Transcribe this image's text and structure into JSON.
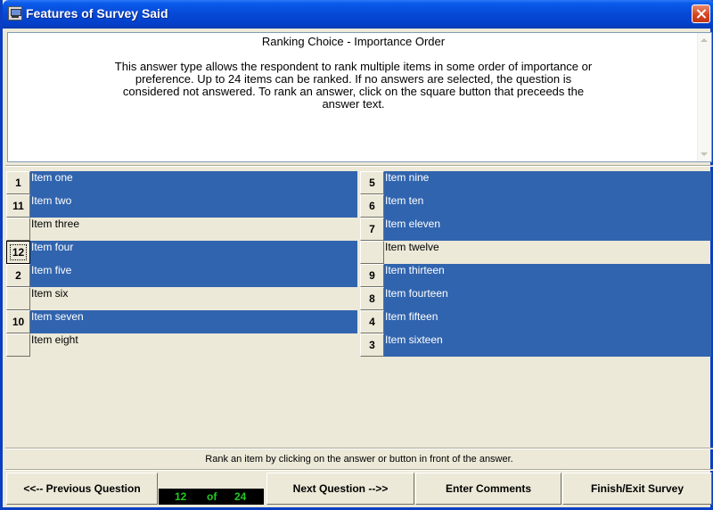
{
  "window": {
    "title": "Features of Survey Said"
  },
  "question": {
    "title": "Ranking Choice - Importance Order",
    "body": "This answer type allows the respondent to rank multiple items in some order of importance or preference. Up to 24 items can be ranked. If no answers are selected, the question is considered not answered. To rank an answer, click on the square button that preceeds the answer text."
  },
  "left_items": [
    {
      "rank": "1",
      "label": "Item one",
      "selected": true
    },
    {
      "rank": "11",
      "label": "Item two",
      "selected": true
    },
    {
      "rank": "",
      "label": "Item three",
      "selected": false
    },
    {
      "rank": "12",
      "label": "Item four",
      "selected": true,
      "focused": true
    },
    {
      "rank": "2",
      "label": "Item five",
      "selected": true
    },
    {
      "rank": "",
      "label": "Item six",
      "selected": false
    },
    {
      "rank": "10",
      "label": "Item seven",
      "selected": true
    },
    {
      "rank": "",
      "label": "Item eight",
      "selected": false
    }
  ],
  "right_items": [
    {
      "rank": "5",
      "label": "Item nine",
      "selected": true
    },
    {
      "rank": "6",
      "label": "Item ten",
      "selected": true
    },
    {
      "rank": "7",
      "label": "Item eleven",
      "selected": true
    },
    {
      "rank": "",
      "label": "Item twelve",
      "selected": false
    },
    {
      "rank": "9",
      "label": "Item thirteen",
      "selected": true
    },
    {
      "rank": "8",
      "label": "Item fourteen",
      "selected": true
    },
    {
      "rank": "4",
      "label": "Item fifteen",
      "selected": true
    },
    {
      "rank": "3",
      "label": "Item sixteen",
      "selected": true
    }
  ],
  "hint": "Rank an item by clicking on the answer or button in front of the answer.",
  "nav": {
    "prev_label": "<<-- Previous Question",
    "next_label": "Next Question -->>",
    "comments_label": "Enter Comments",
    "finish_label": "Finish/Exit Survey"
  },
  "counter": {
    "current": "12",
    "of_label": "of",
    "total": "24"
  },
  "colors": {
    "selected_bg": "#3164ae",
    "counter_fg": "#22c922"
  }
}
